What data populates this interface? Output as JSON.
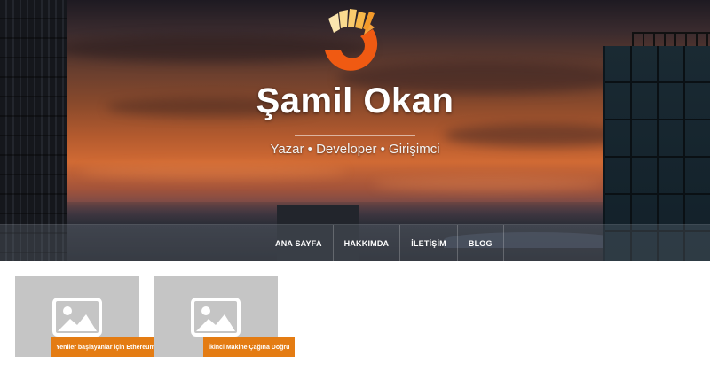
{
  "site": {
    "title": "Şamil Okan",
    "tagline": "Yazar • Developer • Girişimci",
    "logo_icon": "orange-sun-logo-icon"
  },
  "nav": {
    "items": [
      {
        "label": "ANA SAYFA"
      },
      {
        "label": "HAKKIMDA"
      },
      {
        "label": "İLETİŞİM"
      },
      {
        "label": "BLOG"
      }
    ]
  },
  "posts": [
    {
      "title": "Yeniler başlayanlar için Ethereum",
      "thumb_icon": "image-placeholder-icon"
    },
    {
      "title": "İkinci Makine Çağına Doğru",
      "thumb_icon": "image-placeholder-icon"
    }
  ],
  "colors": {
    "accent": "#e47c13",
    "thumb_bg": "#c5c5c5",
    "logo_orange": "#f05a12",
    "logo_yellow": "#f7c35e"
  }
}
